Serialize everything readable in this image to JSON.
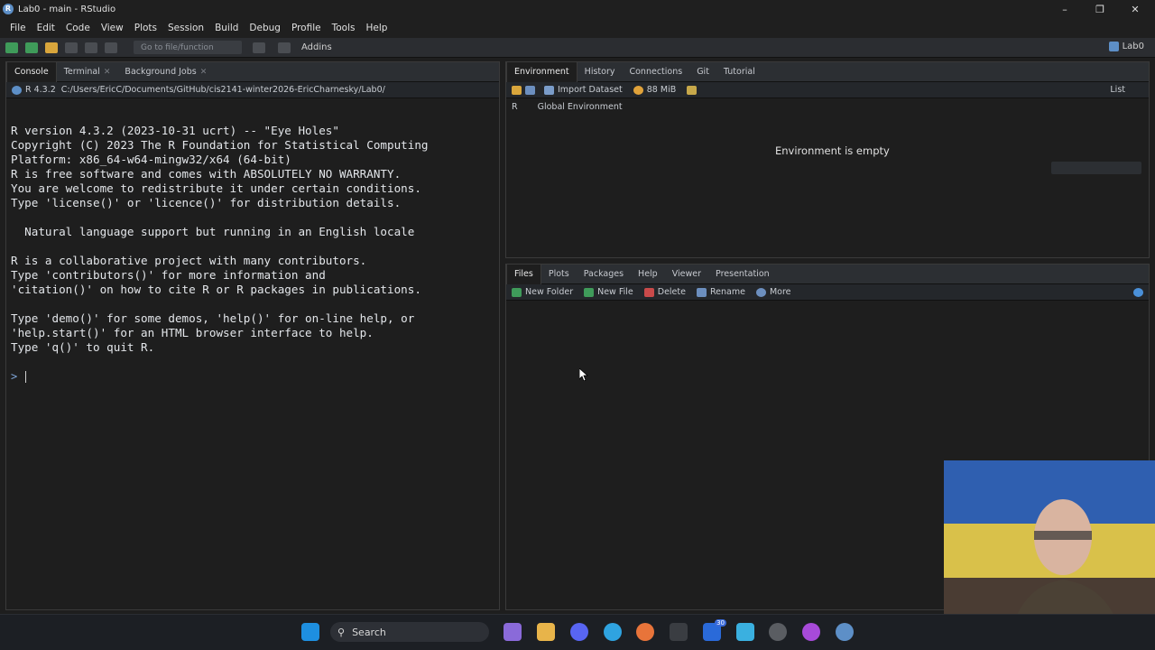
{
  "window": {
    "title": "Lab0 - main - RStudio",
    "project": "Lab0"
  },
  "menu": [
    "File",
    "Edit",
    "Code",
    "View",
    "Plots",
    "Session",
    "Build",
    "Debug",
    "Profile",
    "Tools",
    "Help"
  ],
  "toolbar": {
    "goto_placeholder": "Go to file/function",
    "addins": "Addins"
  },
  "console_pane": {
    "tabs": [
      {
        "label": "Console"
      },
      {
        "label": "Terminal"
      },
      {
        "label": "Background Jobs"
      }
    ],
    "r_version": "R 4.3.2",
    "path": "C:/Users/EricC/Documents/GitHub/cis2141-winter2026-EricCharnesky/Lab0/",
    "lines": [
      "R version 4.3.2 (2023-10-31 ucrt) -- \"Eye Holes\"",
      "Copyright (C) 2023 The R Foundation for Statistical Computing",
      "Platform: x86_64-w64-mingw32/x64 (64-bit)",
      "",
      "R is free software and comes with ABSOLUTELY NO WARRANTY.",
      "You are welcome to redistribute it under certain conditions.",
      "Type 'license()' or 'licence()' for distribution details.",
      "",
      "  Natural language support but running in an English locale",
      "",
      "R is a collaborative project with many contributors.",
      "Type 'contributors()' for more information and",
      "'citation()' on how to cite R or R packages in publications.",
      "",
      "Type 'demo()' for some demos, 'help()' for on-line help, or",
      "'help.start()' for an HTML browser interface to help.",
      "Type 'q()' to quit R."
    ],
    "prompt": ">"
  },
  "env_pane": {
    "tabs": [
      "Environment",
      "History",
      "Connections",
      "Git",
      "Tutorial"
    ],
    "import_dataset": "Import Dataset",
    "memory": "88 MiB",
    "view_mode": "List",
    "language": "R",
    "scope": "Global Environment",
    "empty_message": "Environment is empty"
  },
  "files_pane": {
    "tabs": [
      "Files",
      "Plots",
      "Packages",
      "Help",
      "Viewer",
      "Presentation"
    ],
    "buttons": [
      "New Folder",
      "New File",
      "Delete",
      "Rename",
      "More"
    ]
  },
  "taskbar": {
    "search_label": "Search",
    "badge_count": "30"
  }
}
